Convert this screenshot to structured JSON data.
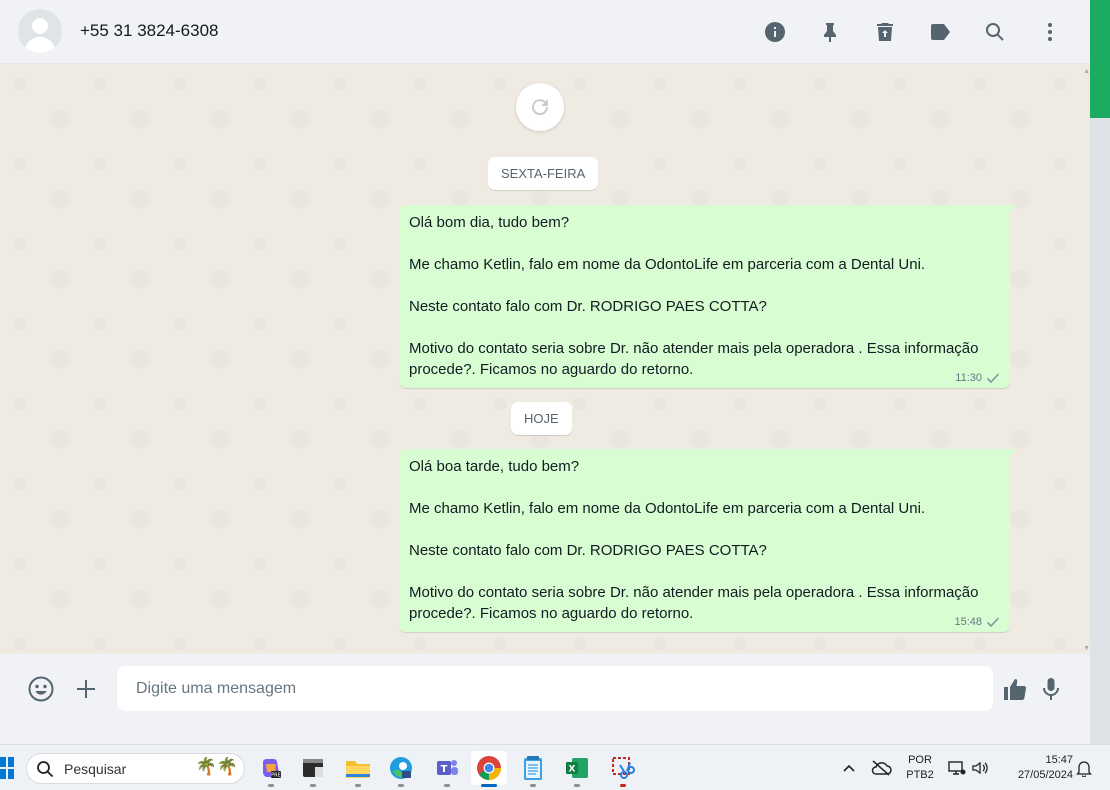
{
  "header": {
    "contact_name": "+55 31 3824-6308",
    "icons": [
      "info-icon",
      "pin-icon",
      "delete-icon",
      "label-icon",
      "search-icon",
      "menu-icon"
    ]
  },
  "chat": {
    "date_chips": [
      "SEXTA-FEIRA",
      "HOJE"
    ],
    "messages": [
      {
        "lines": [
          "Olá bom dia, tudo bem?",
          "Me chamo Ketlin, falo em nome da OdontoLife em parceria com a Dental Uni.",
          "Neste contato falo com Dr. RODRIGO PAES COTTA?",
          "Motivo do contato seria sobre Dr. não atender mais pela operadora . Essa informação procede?. Ficamos no aguardo do retorno."
        ],
        "time": "11:30",
        "status": "sent"
      },
      {
        "lines": [
          "Olá boa tarde, tudo bem?",
          "Me chamo Ketlin, falo em nome da OdontoLife em parceria com a Dental Uni.",
          "Neste contato falo com Dr. RODRIGO PAES COTTA?",
          "Motivo do contato seria sobre Dr. não atender mais pela operadora . Essa informação procede?. Ficamos no aguardo do retorno."
        ],
        "time": "15:48",
        "status": "sent"
      }
    ]
  },
  "composer": {
    "placeholder": "Digite uma mensagem"
  },
  "taskbar": {
    "search_placeholder": "Pesquisar",
    "apps": [
      "copilot",
      "terminal",
      "file-explorer",
      "edge",
      "teams",
      "chrome",
      "notepad",
      "excel",
      "snipping-tool"
    ],
    "active_app": "chrome",
    "lang_top": "POR",
    "lang_bottom": "PTB2",
    "time": "15:47",
    "date": "27/05/2024"
  },
  "colors": {
    "accent_green": "#1daa61",
    "bubble_out": "#d9fdd3",
    "chat_bg": "#efeae2",
    "panel_bg": "#f0f2f5"
  }
}
